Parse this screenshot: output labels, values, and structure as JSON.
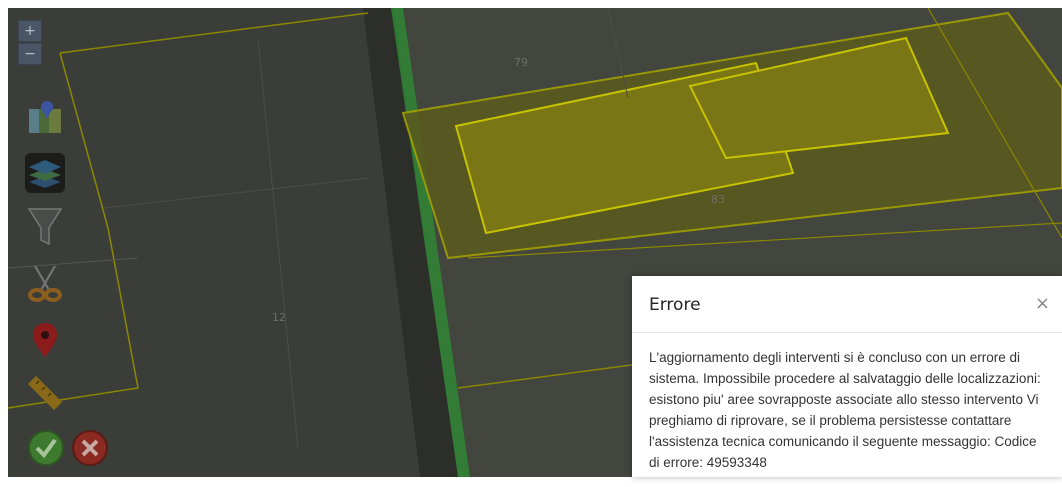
{
  "map": {
    "zoom_in_label": "+",
    "zoom_out_label": "−",
    "parcel_labels": [
      "79",
      "83",
      "12"
    ]
  },
  "toolbar": {
    "tools": [
      {
        "name": "map-layers-icon",
        "icon": "map-pin-icon"
      },
      {
        "name": "layers-icon",
        "icon": "stacked-layers-icon"
      },
      {
        "name": "filter-icon",
        "icon": "funnel-icon"
      },
      {
        "name": "scissors-icon",
        "icon": "cut-icon"
      },
      {
        "name": "marker-icon",
        "icon": "location-pin-icon"
      },
      {
        "name": "ruler-icon",
        "icon": "measure-icon"
      }
    ],
    "confirm_icon": "check-circle-icon",
    "cancel_icon": "cancel-circle-icon"
  },
  "dialog": {
    "title": "Errore",
    "close_label": "×",
    "message": "L'aggiornamento degli interventi si è concluso con un errore di sistema. Impossibile procedere al salvataggio delle localizzazioni: esistono piu' aree sovrapposte associate allo stesso intervento Vi preghiamo di riprovare, se il problema persistesse contattare l'assistenza tecnica comunicando il seguente messaggio: Codice di errore: 49593348"
  },
  "colors": {
    "overlay": "#3c3e3a",
    "highlight": "#b7b400",
    "parcel_line": "#a3a000",
    "green_strip": "#2f8a35"
  }
}
